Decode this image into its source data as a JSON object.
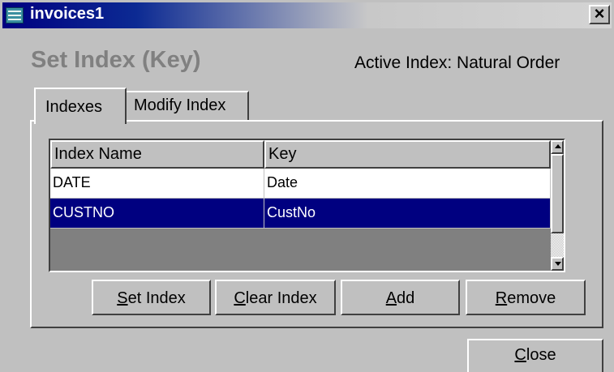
{
  "window": {
    "title": "invoices1",
    "icon": "table-icon",
    "close_label": "×"
  },
  "heading": "Set Index (Key)",
  "active_index_text": "Active Index: Natural Order",
  "tabs": [
    {
      "label": "Indexes",
      "active": true
    },
    {
      "label": "Modify Index",
      "active": false
    }
  ],
  "grid": {
    "columns": [
      "Index Name",
      "Key"
    ],
    "rows": [
      {
        "index_name": "DATE",
        "key": "Date",
        "selected": false
      },
      {
        "index_name": "CUSTNO",
        "key": "CustNo",
        "selected": true
      }
    ]
  },
  "buttons": {
    "set_index": {
      "mnemonic": "S",
      "rest": "et Index"
    },
    "clear_index": {
      "mnemonic": "C",
      "rest": "lear Index"
    },
    "add": {
      "mnemonic": "A",
      "rest": "dd"
    },
    "remove": {
      "mnemonic": "R",
      "rest": "emove"
    },
    "close": {
      "mnemonic": "C",
      "rest": "lose"
    }
  },
  "colors": {
    "title_bar": "#000080",
    "selection": "#000080",
    "face": "#c0c0c0",
    "heading": "#808080"
  }
}
